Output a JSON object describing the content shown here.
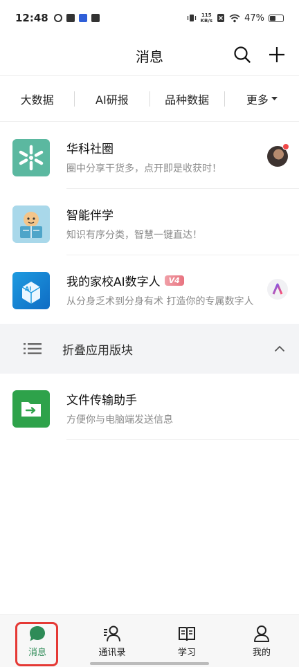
{
  "status_bar": {
    "time": "12:48",
    "net_speed_value": "115",
    "net_speed_unit": "KB/s",
    "battery": "47%",
    "battery_level": 0.47
  },
  "header": {
    "title": "消息"
  },
  "tabs": [
    {
      "label": "大数据"
    },
    {
      "label": "AI研报"
    },
    {
      "label": "品种数据"
    },
    {
      "label": "更多"
    }
  ],
  "conversations": [
    {
      "title": "华科社圈",
      "subtitle": "圈中分享干货多，点开即是收获时！",
      "icon": "huake-logo-icon"
    },
    {
      "title": "智能伴学",
      "subtitle": "知识有序分类，智慧一键直达！",
      "icon": "study-companion-icon"
    },
    {
      "title": "我的家校AI数字人",
      "badge": "V4",
      "subtitle": "从分身乏术到分身有术 打造你的专属数字人",
      "icon": "digital-human-icon"
    }
  ],
  "fold_section": {
    "label": "折叠应用版块"
  },
  "folded_items": [
    {
      "title": "文件传输助手",
      "subtitle": "方便你与电脑端发送信息",
      "icon": "file-transfer-icon"
    }
  ],
  "bottom_nav": [
    {
      "label": "消息",
      "icon": "chat-bubble-icon",
      "active": true
    },
    {
      "label": "通讯录",
      "icon": "contacts-icon",
      "active": false
    },
    {
      "label": "学习",
      "icon": "book-icon",
      "active": false
    },
    {
      "label": "我的",
      "icon": "person-icon",
      "active": false
    }
  ],
  "colors": {
    "accent_green": "#2e8b57",
    "highlight_red": "#e53935",
    "teal_logo": "#5bb8a0"
  }
}
